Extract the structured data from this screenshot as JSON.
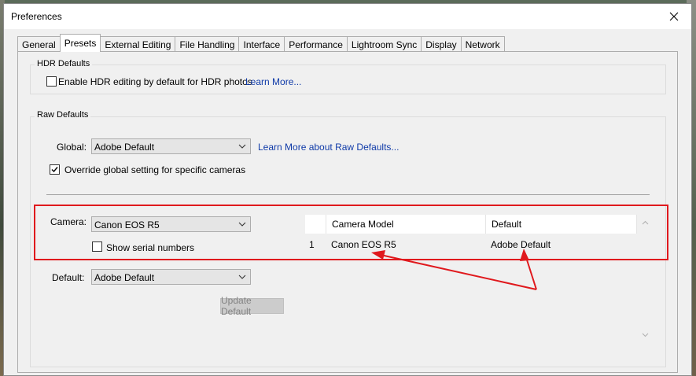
{
  "window": {
    "title": "Preferences",
    "close_icon": "close-icon"
  },
  "tabs": [
    {
      "label": "General",
      "active": false
    },
    {
      "label": "Presets",
      "active": true
    },
    {
      "label": "External Editing",
      "active": false
    },
    {
      "label": "File Handling",
      "active": false
    },
    {
      "label": "Interface",
      "active": false
    },
    {
      "label": "Performance",
      "active": false
    },
    {
      "label": "Lightroom Sync",
      "active": false
    },
    {
      "label": "Display",
      "active": false
    },
    {
      "label": "Network",
      "active": false
    }
  ],
  "hdr": {
    "group_label": "HDR Defaults",
    "checkbox_label": "Enable HDR editing by default for HDR photos",
    "checked": false,
    "learn_more": "Learn More..."
  },
  "raw": {
    "group_label": "Raw Defaults",
    "global_label": "Global:",
    "global_value": "Adobe Default",
    "learn_more": "Learn More about Raw Defaults...",
    "override_label": "Override global setting for specific cameras",
    "override_checked": true,
    "camera_label": "Camera:",
    "camera_value": "Canon EOS R5",
    "serial_label": "Show serial numbers",
    "serial_checked": false,
    "default_label": "Default:",
    "default_value": "Adobe Default",
    "update_button": "Update Default"
  },
  "table": {
    "headers": [
      "",
      "Camera Model",
      "Default"
    ],
    "rows": [
      {
        "index": "1",
        "model": "Canon EOS R5",
        "default": "Adobe Default"
      }
    ]
  },
  "annotation": {
    "color": "#e0191d"
  }
}
